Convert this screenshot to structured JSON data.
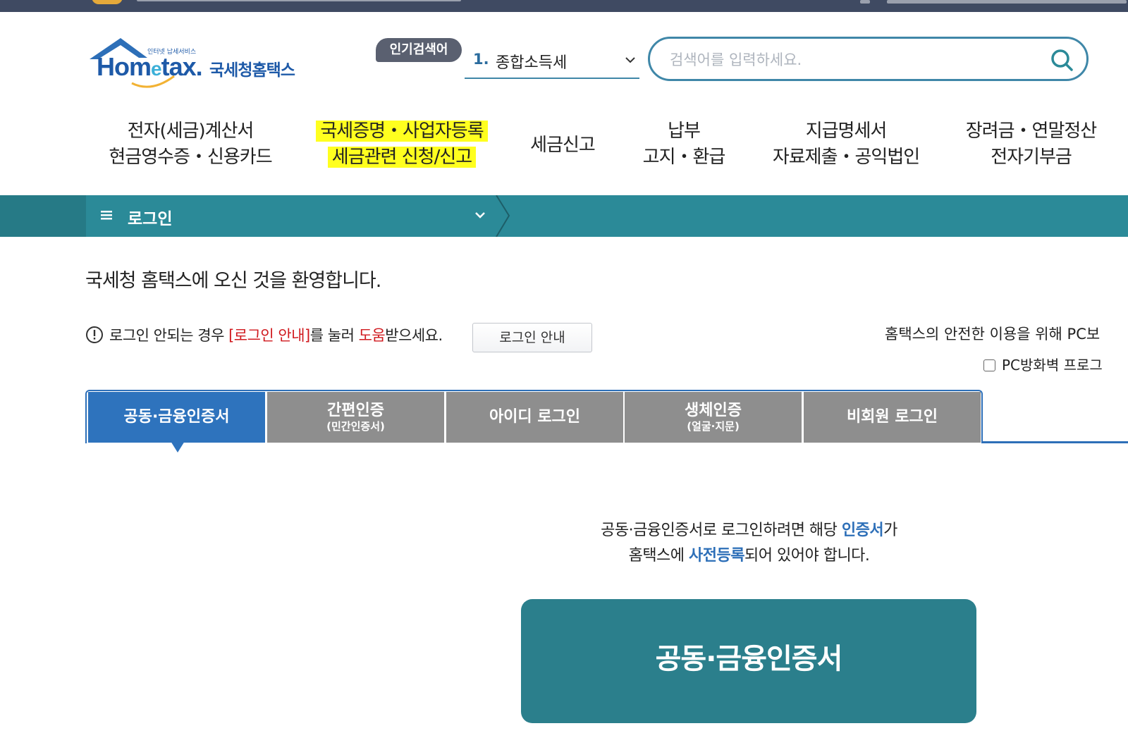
{
  "logo": {
    "small_text": "인터넷 납세서비스",
    "word_a": "Hom",
    "word_e": "e",
    "word_b": "tax.",
    "korean": "국세청홈택스"
  },
  "popular_search": {
    "badge": "인기검색어",
    "rank": "1.",
    "value": "종합소득세"
  },
  "search": {
    "placeholder": "검색어를 입력하세요."
  },
  "main_nav": [
    {
      "line1": "전자(세금)계산서",
      "line2": "현금영수증・신용카드",
      "highlighted": false
    },
    {
      "line1": "국세증명・사업자등록",
      "line2": "세금관련 신청/신고",
      "highlighted": true
    },
    {
      "line1": "세금신고",
      "line2": "",
      "highlighted": false
    },
    {
      "line1": "납부",
      "line2": "고지・환급",
      "highlighted": false
    },
    {
      "line1": "지급명세서",
      "line2": "자료제출・공익법인",
      "highlighted": false
    },
    {
      "line1": "장려금・연말정산",
      "line2": "전자기부금",
      "highlighted": false
    }
  ],
  "breadcrumb": {
    "label": "로그인"
  },
  "welcome": "국세청 홈택스에 오신 것을 환영합니다.",
  "help": {
    "text_a": "로그인 안되는 경우 ",
    "text_link": "[로그인 안내]",
    "text_b": "를 눌러 ",
    "text_red": "도움",
    "text_c": "받으세요.",
    "button": "로그인 안내"
  },
  "safety_text": "홈택스의 안전한 이용을 위해 PC보",
  "firewall_checkbox": "PC방화벽 프로그",
  "tabs": [
    {
      "label": "공동·금융인증서",
      "sub": "",
      "active": true
    },
    {
      "label": "간편인증",
      "sub": "(민간인증서)",
      "active": false
    },
    {
      "label": "아이디 로그인",
      "sub": "",
      "active": false
    },
    {
      "label": "생체인증",
      "sub": "(얼굴·지문)",
      "active": false
    },
    {
      "label": "비회원 로그인",
      "sub": "",
      "active": false
    }
  ],
  "notice": {
    "line1_a": "공동·금융인증서로 로그인하려면 해당 ",
    "line1_blue": "인증서",
    "line1_b": "가",
    "line2_a": "홈택스에 ",
    "line2_blue": "사전등록",
    "line2_b": "되어 있어야 합니다."
  },
  "cert_button": "공동·금융인증서",
  "colors": {
    "teal": "#2b8a98",
    "tab_active": "#2e73bd",
    "tab_inactive": "#8e8e8e",
    "highlight": "#ffff1f",
    "link_red": "#d0191e"
  }
}
